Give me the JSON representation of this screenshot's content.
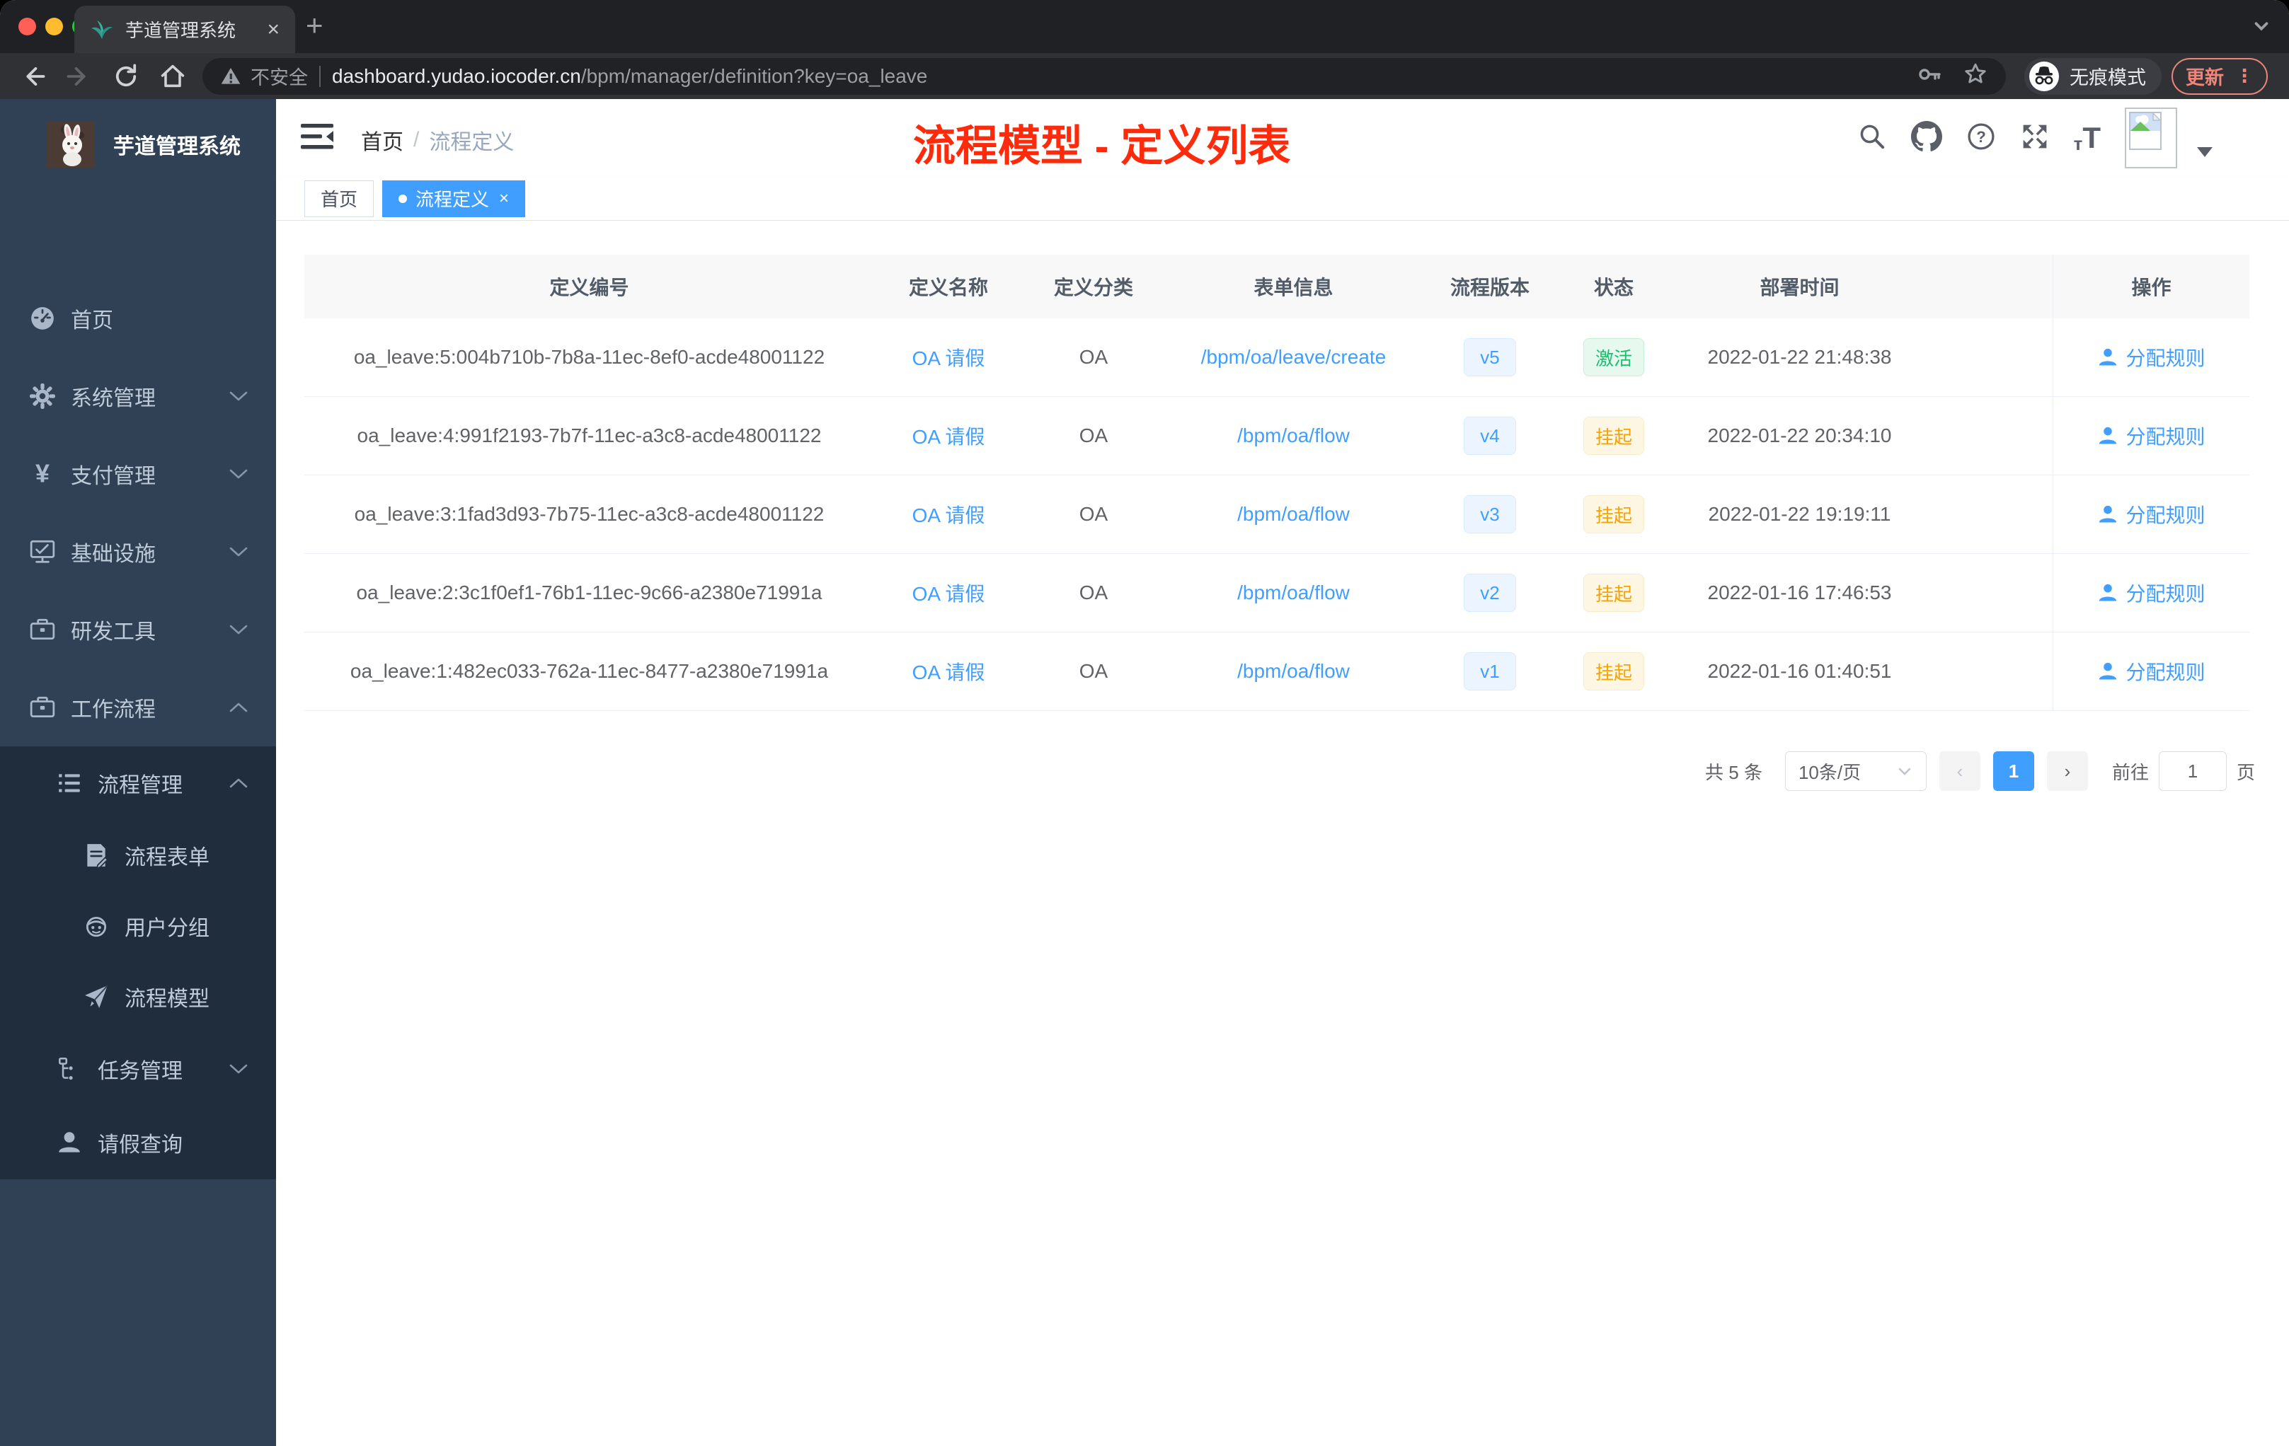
{
  "browser": {
    "tab_title": "芋道管理系统",
    "new_tab": "+",
    "close_tab": "×",
    "not_secure": "不安全",
    "url_host": "dashboard.yudao.iocoder.cn",
    "url_path": "/bpm/manager/definition?key=oa_leave",
    "incognito_label": "无痕模式",
    "update_label": "更新",
    "menu_dots": "⋮"
  },
  "sidebar": {
    "brand": "芋道管理系统",
    "menu": [
      {
        "label": "首页",
        "icon": "dashboard-icon",
        "level": 1,
        "chevron": "",
        "sub": false
      },
      {
        "label": "系统管理",
        "icon": "gear-icon",
        "level": 1,
        "chevron": "down",
        "sub": false
      },
      {
        "label": "支付管理",
        "icon": "yen-icon",
        "level": 1,
        "chevron": "down",
        "sub": false
      },
      {
        "label": "基础设施",
        "icon": "monitor-icon",
        "level": 1,
        "chevron": "down",
        "sub": false
      },
      {
        "label": "研发工具",
        "icon": "briefcase-icon",
        "level": 1,
        "chevron": "down",
        "sub": false
      },
      {
        "label": "工作流程",
        "icon": "briefcase-icon",
        "level": 1,
        "chevron": "up",
        "sub": false
      },
      {
        "label": "流程管理",
        "icon": "list-icon",
        "level": 2,
        "chevron": "up",
        "sub": true
      },
      {
        "label": "流程表单",
        "icon": "form-icon",
        "level": 3,
        "chevron": "",
        "sub": true
      },
      {
        "label": "用户分组",
        "icon": "robot-icon",
        "level": 3,
        "chevron": "",
        "sub": true
      },
      {
        "label": "流程模型",
        "icon": "plane-icon",
        "level": 3,
        "chevron": "",
        "sub": true
      },
      {
        "label": "任务管理",
        "icon": "flow-icon",
        "level": 2,
        "chevron": "down",
        "sub": true
      },
      {
        "label": "请假查询",
        "icon": "user-icon",
        "level": 2,
        "chevron": "",
        "sub": true
      }
    ]
  },
  "header": {
    "breadcrumb": [
      "首页",
      "流程定义"
    ],
    "separator": "/",
    "annotation": "流程模型 - 定义列表"
  },
  "tags": [
    {
      "label": "首页",
      "active": false
    },
    {
      "label": "流程定义",
      "active": true,
      "close": "×"
    }
  ],
  "table": {
    "columns": [
      "定义编号",
      "定义名称",
      "定义分类",
      "表单信息",
      "流程版本",
      "状态",
      "部署时间",
      "操作"
    ],
    "rows": [
      {
        "id": "oa_leave:5:004b710b-7b8a-11ec-8ef0-acde48001122",
        "name": "OA 请假",
        "category": "OA",
        "form": "/bpm/oa/leave/create",
        "version": "v5",
        "status": "激活",
        "status_type": "success",
        "deploy_time": "2022-01-22 21:48:38",
        "action": "分配规则"
      },
      {
        "id": "oa_leave:4:991f2193-7b7f-11ec-a3c8-acde48001122",
        "name": "OA 请假",
        "category": "OA",
        "form": "/bpm/oa/flow",
        "version": "v4",
        "status": "挂起",
        "status_type": "warning",
        "deploy_time": "2022-01-22 20:34:10",
        "action": "分配规则"
      },
      {
        "id": "oa_leave:3:1fad3d93-7b75-11ec-a3c8-acde48001122",
        "name": "OA 请假",
        "category": "OA",
        "form": "/bpm/oa/flow",
        "version": "v3",
        "status": "挂起",
        "status_type": "warning",
        "deploy_time": "2022-01-22 19:19:11",
        "action": "分配规则"
      },
      {
        "id": "oa_leave:2:3c1f0ef1-76b1-11ec-9c66-a2380e71991a",
        "name": "OA 请假",
        "category": "OA",
        "form": "/bpm/oa/flow",
        "version": "v2",
        "status": "挂起",
        "status_type": "warning",
        "deploy_time": "2022-01-16 17:46:53",
        "action": "分配规则"
      },
      {
        "id": "oa_leave:1:482ec033-762a-11ec-8477-a2380e71991a",
        "name": "OA 请假",
        "category": "OA",
        "form": "/bpm/oa/flow",
        "version": "v1",
        "status": "挂起",
        "status_type": "warning",
        "deploy_time": "2022-01-16 01:40:51",
        "action": "分配规则"
      }
    ]
  },
  "pagination": {
    "total": "共 5 条",
    "page_size": "10条/页",
    "prev": "‹",
    "current_page": "1",
    "next": "›",
    "goto_label": "前往",
    "goto_value": "1",
    "page_unit": "页"
  },
  "colors": {
    "accent": "#409eff",
    "annotation_red": "#fd2b0c",
    "success_green": "#1cbe6e",
    "warning_orange": "#f5a300",
    "sidebar_bg": "#304156",
    "submenu_bg": "#1f2d3d",
    "active_tag": "#409eff",
    "update_salmon": "#f08479"
  }
}
